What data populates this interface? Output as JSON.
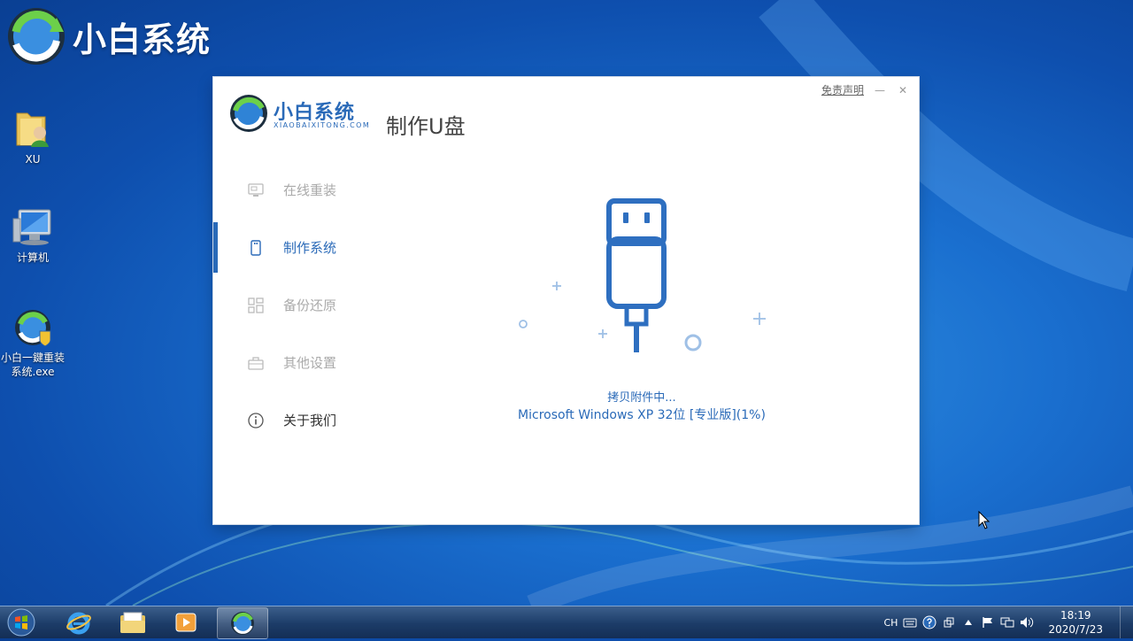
{
  "desktop": {
    "brand_name": "小白系统",
    "icons": [
      {
        "label": "XU"
      },
      {
        "label": "计算机"
      },
      {
        "label": "小白一鍵重装系统.exe"
      }
    ]
  },
  "window": {
    "disclaimer": "免责声明",
    "minimize_glyph": "—",
    "close_glyph": "✕",
    "app_name": "小白系统",
    "app_subtitle": "XIAOBAIXITONG.COM",
    "page_title": "制作U盘",
    "nav": [
      {
        "label": "在线重装",
        "icon": "monitor-icon",
        "active": false
      },
      {
        "label": "制作系统",
        "icon": "usb-drive-icon",
        "active": true
      },
      {
        "label": "备份还原",
        "icon": "grid-icon",
        "active": false
      },
      {
        "label": "其他设置",
        "icon": "toolbox-icon",
        "active": false
      },
      {
        "label": "关于我们",
        "icon": "info-icon",
        "active": false
      }
    ],
    "status_text": "拷贝附件中...",
    "detail_text": "Microsoft Windows XP 32位 [专业版](1%)",
    "progress_percent": 1
  },
  "taskbar": {
    "tray": {
      "language": "CH",
      "time": "18:19",
      "date": "2020/7/23"
    }
  },
  "colors": {
    "accent": "#2a6ab8",
    "desktop_bg": "#1a6fcf",
    "nav_inactive": "#aaaaaa"
  }
}
